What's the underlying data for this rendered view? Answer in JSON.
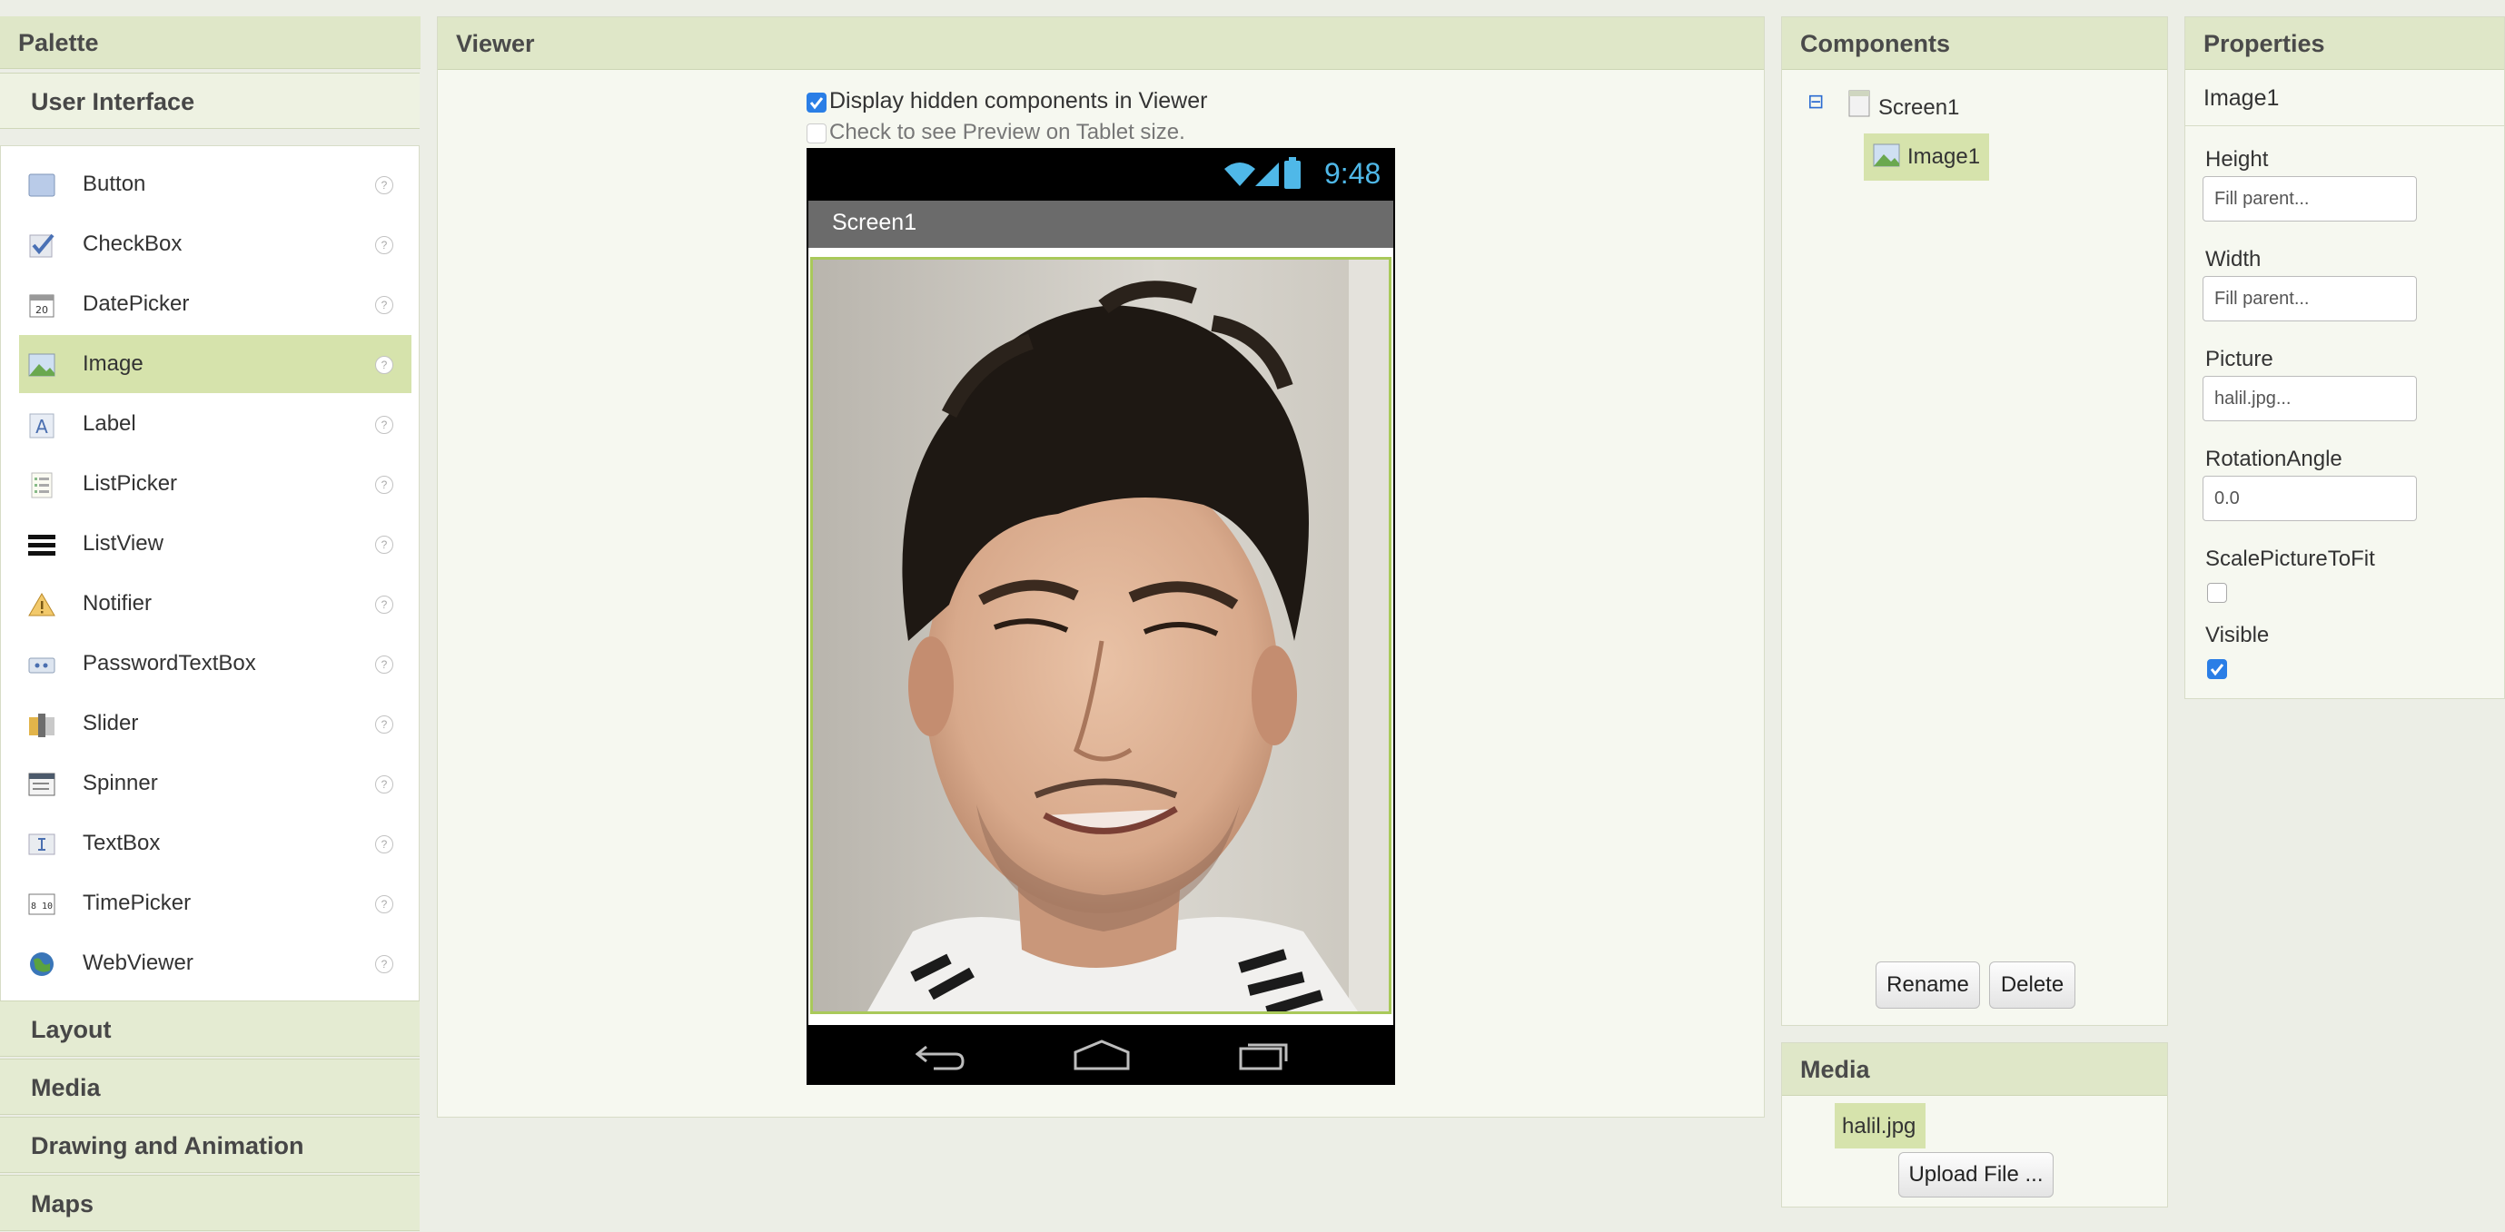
{
  "palette": {
    "title": "Palette",
    "active_category": "User Interface",
    "items": [
      {
        "label": "Button",
        "icon": "button-icon"
      },
      {
        "label": "CheckBox",
        "icon": "checkbox-icon"
      },
      {
        "label": "DatePicker",
        "icon": "datepicker-icon"
      },
      {
        "label": "Image",
        "icon": "image-icon",
        "selected": true
      },
      {
        "label": "Label",
        "icon": "label-icon"
      },
      {
        "label": "ListPicker",
        "icon": "listpicker-icon"
      },
      {
        "label": "ListView",
        "icon": "listview-icon"
      },
      {
        "label": "Notifier",
        "icon": "notifier-icon"
      },
      {
        "label": "PasswordTextBox",
        "icon": "passwordtextbox-icon"
      },
      {
        "label": "Slider",
        "icon": "slider-icon"
      },
      {
        "label": "Spinner",
        "icon": "spinner-icon"
      },
      {
        "label": "TextBox",
        "icon": "textbox-icon"
      },
      {
        "label": "TimePicker",
        "icon": "timepicker-icon"
      },
      {
        "label": "WebViewer",
        "icon": "webviewer-icon"
      }
    ],
    "help_glyph": "?",
    "categories": [
      "Layout",
      "Media",
      "Drawing and Animation",
      "Maps"
    ],
    "calendar_icon_text": "20",
    "timepicker_icon_text": "8 10"
  },
  "viewer": {
    "title": "Viewer",
    "display_hidden_label": "Display hidden components in Viewer",
    "display_hidden_checked": true,
    "tablet_preview_label": "Check to see Preview on Tablet size.",
    "tablet_preview_checked": false,
    "phone": {
      "time": "9:48",
      "screen_title": "Screen1"
    }
  },
  "components": {
    "title": "Components",
    "collapse_glyph": "⊟",
    "tree": [
      {
        "label": "Screen1"
      },
      {
        "label": "Image1",
        "selected": true
      }
    ],
    "rename_label": "Rename",
    "delete_label": "Delete"
  },
  "media": {
    "title": "Media",
    "files": [
      "halil.jpg"
    ],
    "upload_label": "Upload File ..."
  },
  "properties": {
    "title": "Properties",
    "component": "Image1",
    "height_label": "Height",
    "height_value": "Fill parent...",
    "width_label": "Width",
    "width_value": "Fill parent...",
    "picture_label": "Picture",
    "picture_value": "halil.jpg...",
    "rotation_label": "RotationAngle",
    "rotation_value": "0.0",
    "scale_label": "ScalePictureToFit",
    "scale_checked": false,
    "visible_label": "Visible",
    "visible_checked": true
  },
  "colors": {
    "accent_green": "#dfe7c8",
    "selection_green": "#d6e3ac",
    "checkbox_blue": "#2a7ee6"
  }
}
